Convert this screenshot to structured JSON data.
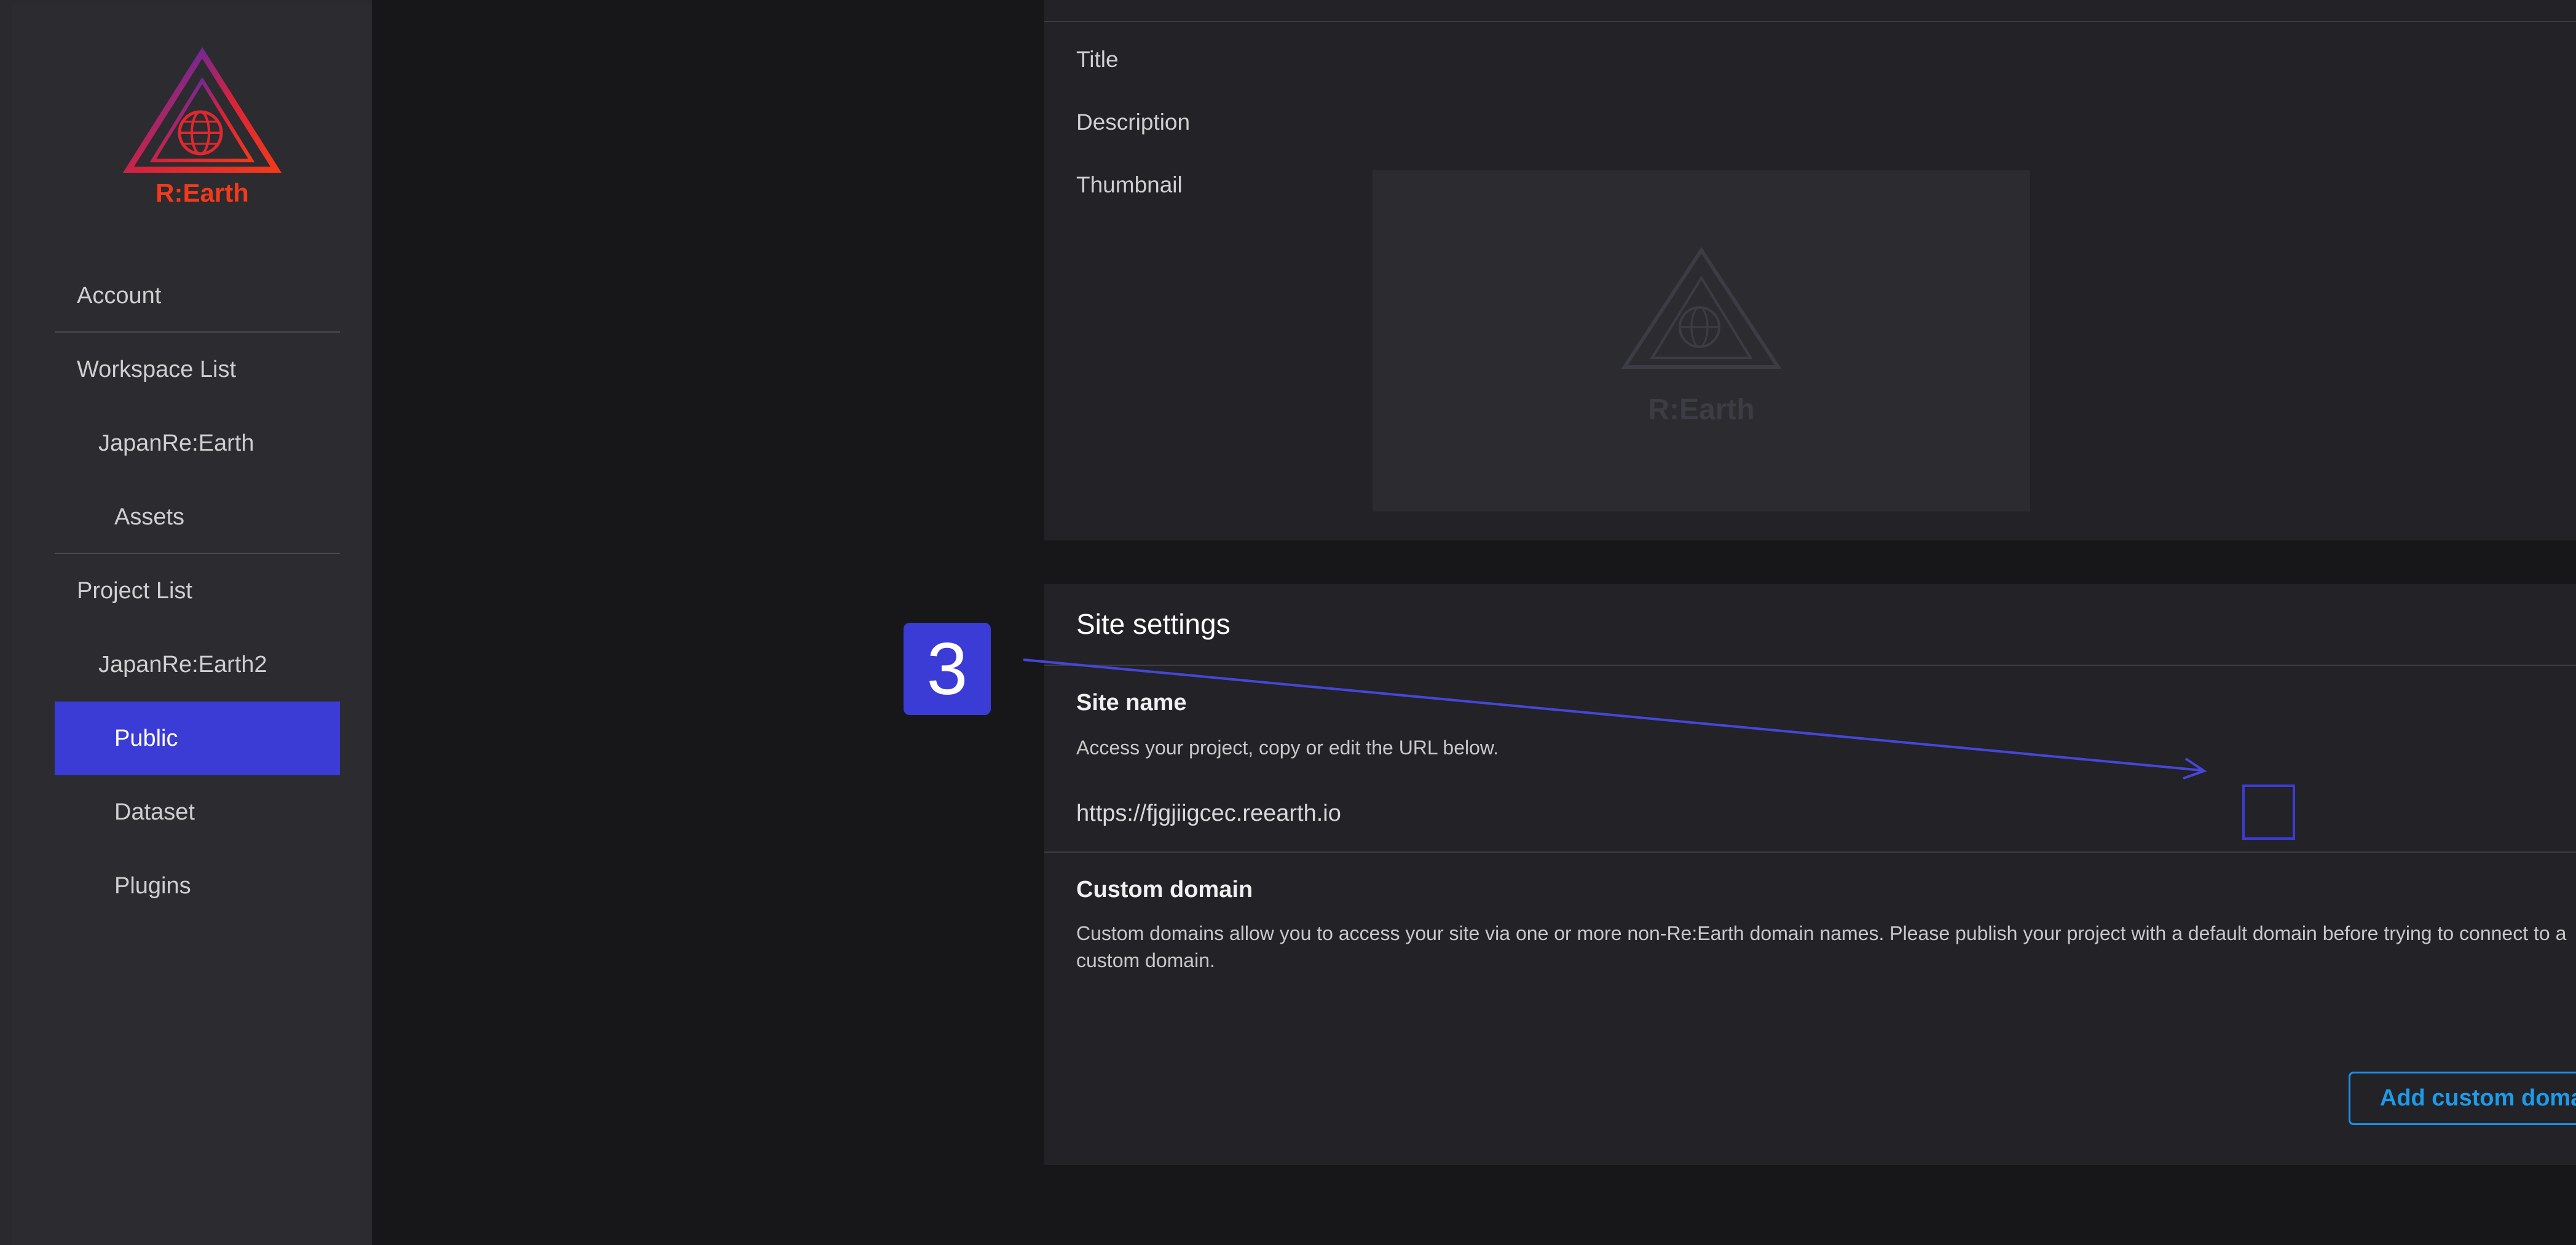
{
  "app": {
    "logo_text": "R:Earth",
    "accent_color": "#3b3bd6",
    "link_color": "#1e9be8"
  },
  "sidebar": {
    "items": [
      {
        "label": "Account"
      },
      {
        "label": "Workspace List"
      },
      {
        "label": "JapanRe:Earth"
      },
      {
        "label": "Assets"
      },
      {
        "label": "Project List"
      },
      {
        "label": "JapanRe:Earth2"
      },
      {
        "label": "Public",
        "active": true
      },
      {
        "label": "Dataset"
      },
      {
        "label": "Plugins"
      }
    ]
  },
  "public_info": {
    "title_label": "Title",
    "description_label": "Description",
    "thumbnail_label": "Thumbnail",
    "thumbnail_placeholder_text": "R:Earth"
  },
  "site_settings": {
    "heading": "Site settings",
    "site_name_label": "Site name",
    "site_name_help": "Access your project, copy or edit the URL below.",
    "site_url": "https://fjgjiigcec.reearth.io",
    "custom_domain_label": "Custom domain",
    "custom_domain_help": "Custom domains allow you to access your site via one or more non-Re:Earth domain names. Please publish your project with a default domain before trying to connect to a custom domain.",
    "add_custom_domain_label": "Add custom domain"
  },
  "annotation": {
    "step_number": "3"
  },
  "icons": {
    "edit": "pencil-icon",
    "embed": "code-icon",
    "logo": "reearth-logo"
  }
}
